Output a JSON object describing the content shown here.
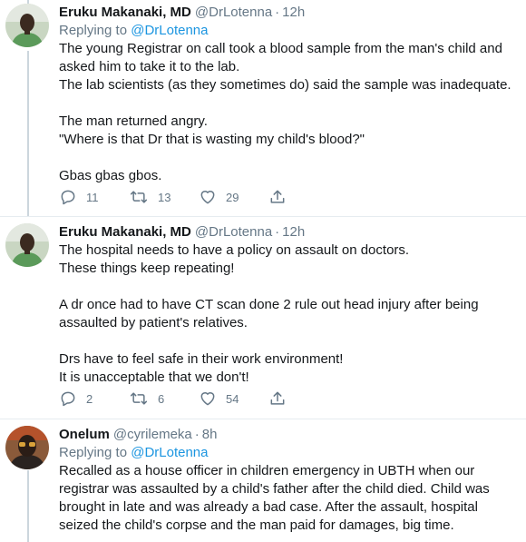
{
  "tweets": [
    {
      "author_name": "Eruku Makanaki, MD",
      "author_handle": "@DrLotenna",
      "separator": "·",
      "time": "12h",
      "reply_prefix": "Replying to",
      "reply_mention": "@DrLotenna",
      "text": "The young Registrar on call took a blood sample from the man's child and asked him to take it to the lab.\nThe lab scientists (as they sometimes do) said the sample was inadequate.\n\nThe man returned angry.\n\"Where is that Dr that is wasting my child's blood?\"\n\nGbas gbas gbos.",
      "reply_count": "11",
      "retweet_count": "13",
      "like_count": "29",
      "avatar_icon": "avatar-man-green-shirt",
      "reply_icon": "speech-bubble-icon",
      "retweet_icon": "retweet-arrows-icon",
      "like_icon": "heart-icon",
      "share_icon": "share-upload-icon"
    },
    {
      "author_name": "Eruku Makanaki, MD",
      "author_handle": "@DrLotenna",
      "separator": "·",
      "time": "12h",
      "text": "The hospital needs to have a policy on assault on doctors.\nThese things keep repeating!\n\nA dr once had to have CT scan done 2 rule out head injury after being assaulted by patient's relatives.\n\nDrs have to feel safe in their work environment!\nIt is unacceptable that we don't!",
      "reply_count": "2",
      "retweet_count": "6",
      "like_count": "54",
      "avatar_icon": "avatar-man-green-shirt"
    },
    {
      "author_name": "Onelum",
      "author_handle": "@cyrilemeka",
      "separator": "·",
      "time": "8h",
      "reply_prefix": "Replying to",
      "reply_mention": "@DrLotenna",
      "text": "Recalled as a house officer in children emergency in UBTH when our registrar was assaulted by a child's father after the child died. Child was brought in late and was already a bad case. After the assault, hospital seized the child's corpse and the man paid for damages, big time.",
      "avatar_icon": "avatar-man-glasses"
    }
  ],
  "colors": {
    "text": "#14171a",
    "muted": "#657786",
    "link": "#1b95e0",
    "divider": "#e6ecf0",
    "thread_line": "#ccd6dd"
  }
}
